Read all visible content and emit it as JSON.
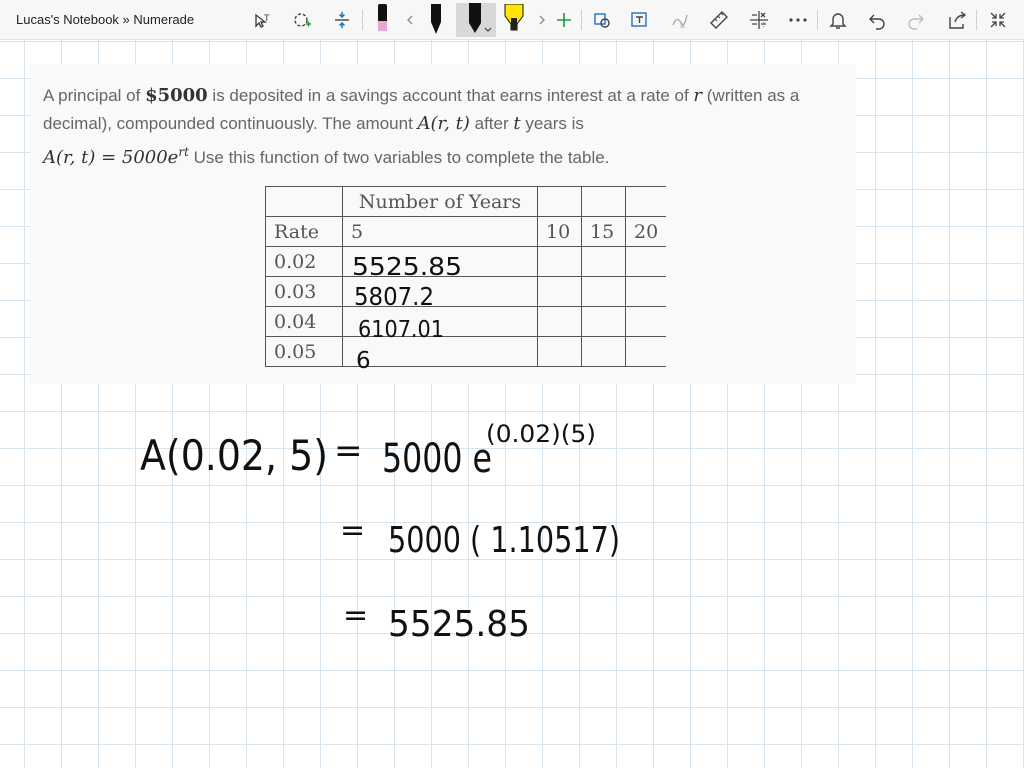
{
  "window": {
    "title": "Lucas's Notebook » Numerade"
  },
  "toolbar": {
    "icons": [
      "lasso-select-icon",
      "insert-shape-icon",
      "insert-space-icon",
      "pen-icon",
      "highlighter-icon",
      "add-pen-icon",
      "ink-to-shape-icon",
      "ink-to-text-icon",
      "ink-to-math-icon",
      "ruler-icon",
      "math-icon",
      "more-icon",
      "notifications-icon",
      "undo-icon",
      "redo-icon",
      "share-icon",
      "fullscreen-icon"
    ],
    "pen_colors": {
      "pink_pen": "#e9a7d6",
      "black_pen": "#111111",
      "black_pen_active": "#111111",
      "yellow_highlighter": "#ffe600",
      "accent": "#1a73c8"
    }
  },
  "problem": {
    "t1": "A principal of ",
    "principal": "$5000",
    "t2": " is deposited in a savings account that earns interest at a rate of ",
    "var_r": "r",
    "t3": " (written as a decimal), compounded continuously. The amount ",
    "func_a": "A(r, t)",
    "t4": " after ",
    "var_t": "t",
    "t5": " years is",
    "formula_lhs": "A(r, t) = 5000e",
    "formula_exp": "rt",
    "t6": " Use this function of two variables to complete the table."
  },
  "table": {
    "header_top": "Number of Years",
    "header_rate": "Rate",
    "years": [
      "5",
      "10",
      "15",
      "20"
    ],
    "rates": [
      "0.02",
      "0.03",
      "0.04",
      "0.05"
    ]
  },
  "handwriting": {
    "cell_values": [
      "5525.85",
      "5807.2",
      "6107.01",
      "6"
    ],
    "line1_lhs": "A(0.02, 5)",
    "line1_eq": "=",
    "line1_base": "5000 e",
    "line1_exp": "(0.02)(5)",
    "line2_eq": "=",
    "line2_rhs": "5000 ( 1.10517)",
    "line3_eq": "=",
    "line3_rhs": "5525.85",
    "ink_color": "#111111"
  }
}
